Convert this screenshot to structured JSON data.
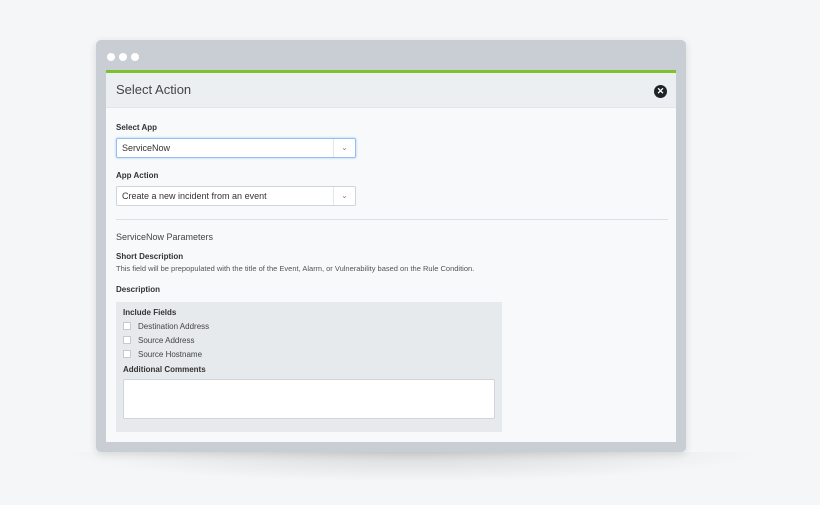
{
  "window": {
    "dots": [
      "dot",
      "dot",
      "dot"
    ]
  },
  "dialog": {
    "title": "Select Action",
    "close_icon": "close-icon",
    "accent_color": "#7cc22e"
  },
  "select_app": {
    "label": "Select App",
    "value": "ServiceNow"
  },
  "app_action": {
    "label": "App Action",
    "value": "Create a new incident from an event"
  },
  "parameters": {
    "title": "ServiceNow Parameters",
    "short_description_label": "Short Description",
    "short_description_help": "This field will be prepopulated with the title of the Event, Alarm, or Vulnerability based on the Rule Condition.",
    "description_label": "Description",
    "include_fields_label": "Include Fields",
    "fields": [
      "Destination Address",
      "Source Address",
      "Source Hostname"
    ],
    "additional_comments_label": "Additional Comments",
    "additional_comments_value": ""
  }
}
